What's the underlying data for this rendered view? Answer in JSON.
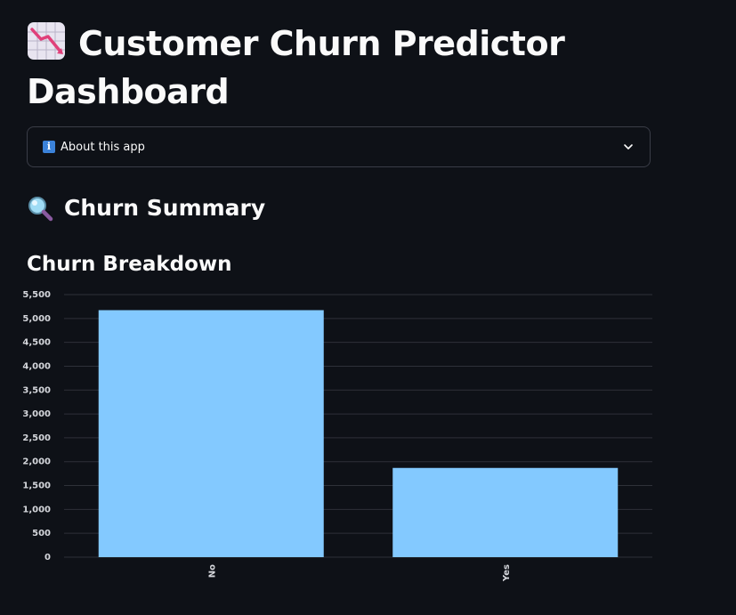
{
  "page": {
    "title": "Customer Churn Predictor Dashboard",
    "title_icon": "chart-decreasing-icon"
  },
  "expander": {
    "label": "About this app",
    "icon": "info-icon",
    "chevron": "chevron-down-icon"
  },
  "summary": {
    "heading": "Churn Summary",
    "icon": "magnifying-glass-icon"
  },
  "breakdown": {
    "heading": "Churn Breakdown"
  },
  "colors": {
    "background": "#0e1117",
    "bar": "#83c9ff",
    "gridline": "#2e3139",
    "text": "#fafafa"
  },
  "chart_data": {
    "type": "bar",
    "categories": [
      "No",
      "Yes"
    ],
    "values": [
      5174,
      1869
    ],
    "xlabel": "",
    "ylabel": "",
    "ylim": [
      0,
      5500
    ],
    "yticks": [
      0,
      500,
      1000,
      1500,
      2000,
      2500,
      3000,
      3500,
      4000,
      4500,
      5000,
      5500
    ],
    "ytick_labels": [
      "0",
      "500",
      "1,000",
      "1,500",
      "2,000",
      "2,500",
      "3,000",
      "3,500",
      "4,000",
      "4,500",
      "5,000",
      "5,500"
    ],
    "grid": true
  }
}
